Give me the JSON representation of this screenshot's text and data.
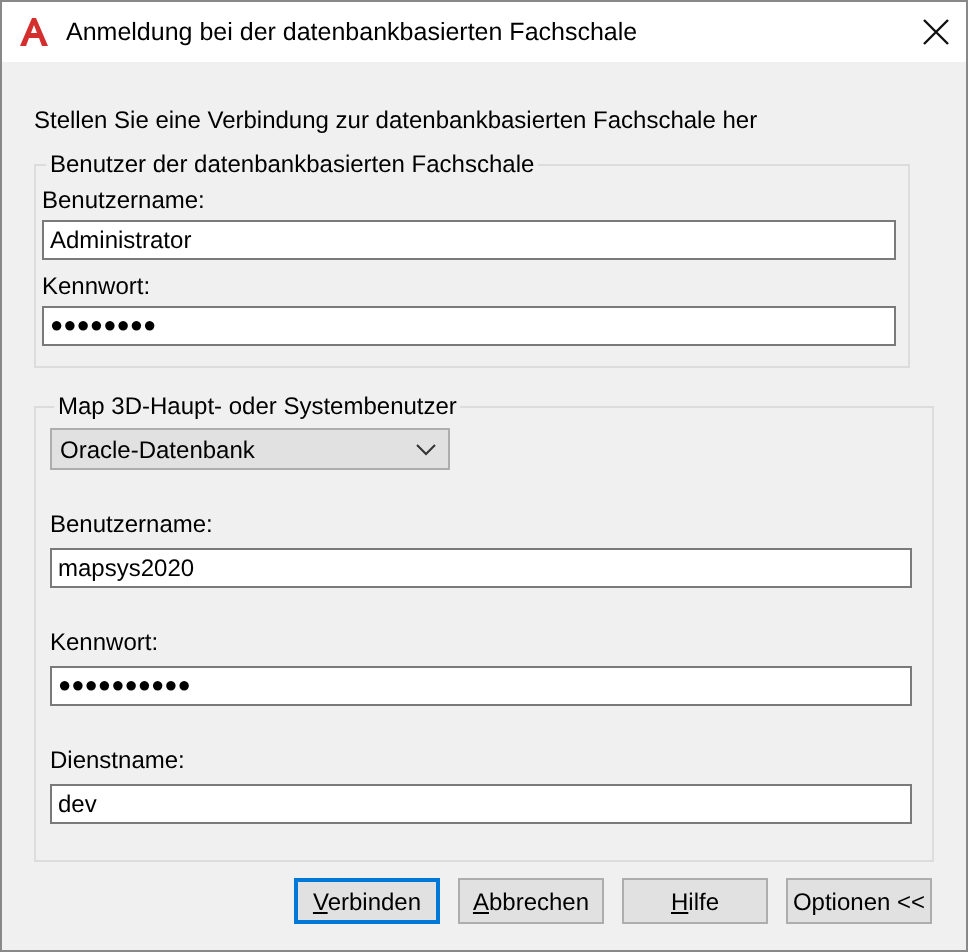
{
  "window": {
    "title": "Anmeldung bei der datenbankbasierten Fachschale"
  },
  "intro": "Stellen Sie eine Verbindung zur datenbankbasierten Fachschale her",
  "groups": [
    {
      "title": "Benutzer der datenbankbasierten Fachschale",
      "fields": [
        {
          "kind": "text",
          "label": "Benutzername:",
          "value": "Administrator"
        },
        {
          "kind": "password",
          "label": "Kennwort:",
          "value": "●●●●●●●●"
        }
      ]
    },
    {
      "title": "Map 3D-Haupt- oder Systembenutzer",
      "fields": [
        {
          "kind": "dropdown",
          "value": "Oracle-Datenbank"
        },
        {
          "kind": "text",
          "label": "Benutzername:",
          "value": "mapsys2020"
        },
        {
          "kind": "password",
          "label": "Kennwort:",
          "value": "●●●●●●●●●●"
        },
        {
          "kind": "text",
          "label": "Dienstname:",
          "value": "dev"
        }
      ]
    }
  ],
  "buttons": [
    {
      "label": "Verbinden",
      "default": true,
      "underlined_first_letter": true
    },
    {
      "label": "Abbrechen",
      "default": false,
      "underlined_first_letter": true
    },
    {
      "label": "Hilfe",
      "default": false,
      "underlined_first_letter": true
    },
    {
      "label": "Optionen <<",
      "default": false,
      "underlined_first_letter": false
    }
  ]
}
